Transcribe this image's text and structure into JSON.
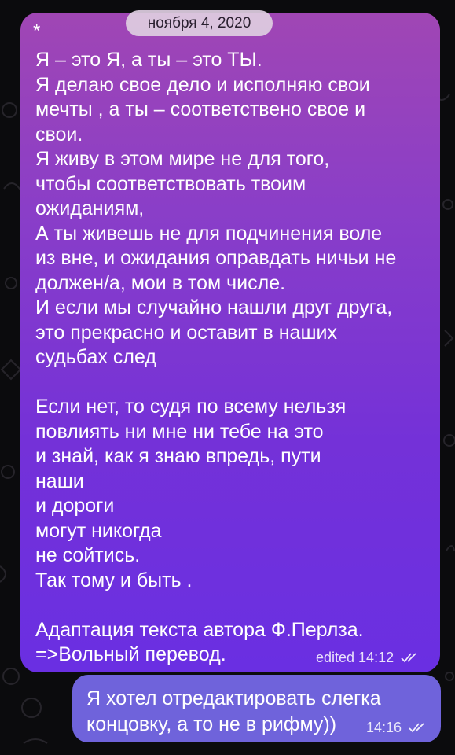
{
  "chat": {
    "date_label": "ноября 4, 2020",
    "incoming": {
      "lines": [
        "*",
        "Я – это Я, а ты – это ТЫ.",
        "Я делаю свое дело и исполняю свои",
        "мечты , а ты – соответствено свое и",
        "свои.",
        "Я живу в этом мире не для того,",
        "чтобы соответствовать твоим",
        "ожиданиям,",
        "А ты живешь не для подчинения воле",
        "из вне, и ожидания оправдать ничьи не",
        "должен/а, мои в том числе.",
        "И если мы случайно нашли друг друга,",
        "это прекрасно и оставит в наших",
        "судьбах след",
        "",
        "Если нет, то судя по всему нельзя",
        "повлиять ни мне ни тебе на это",
        "и знай, как я знаю впредь, пути",
        "наши",
        "и дороги",
        "могут никогда",
        "не сойтись.",
        "Так тому и быть .",
        "",
        "Адаптация текста автора Ф.Перлза.",
        "=>Вольный перевод."
      ],
      "meta": "edited 14:12",
      "status_icon": "double-check-icon"
    },
    "outgoing": {
      "lines": [
        "Я хотел отредактировать слегка",
        "концовку, а то не в рифму))"
      ],
      "time": "14:16",
      "status_icon": "double-check-icon"
    }
  },
  "colors": {
    "bubble_in_top": "#a046b4",
    "bubble_in_bottom": "#6a2fe2",
    "bubble_out": "#6f63db",
    "date_pill": "#decee1",
    "background": "#0b0b0d"
  }
}
